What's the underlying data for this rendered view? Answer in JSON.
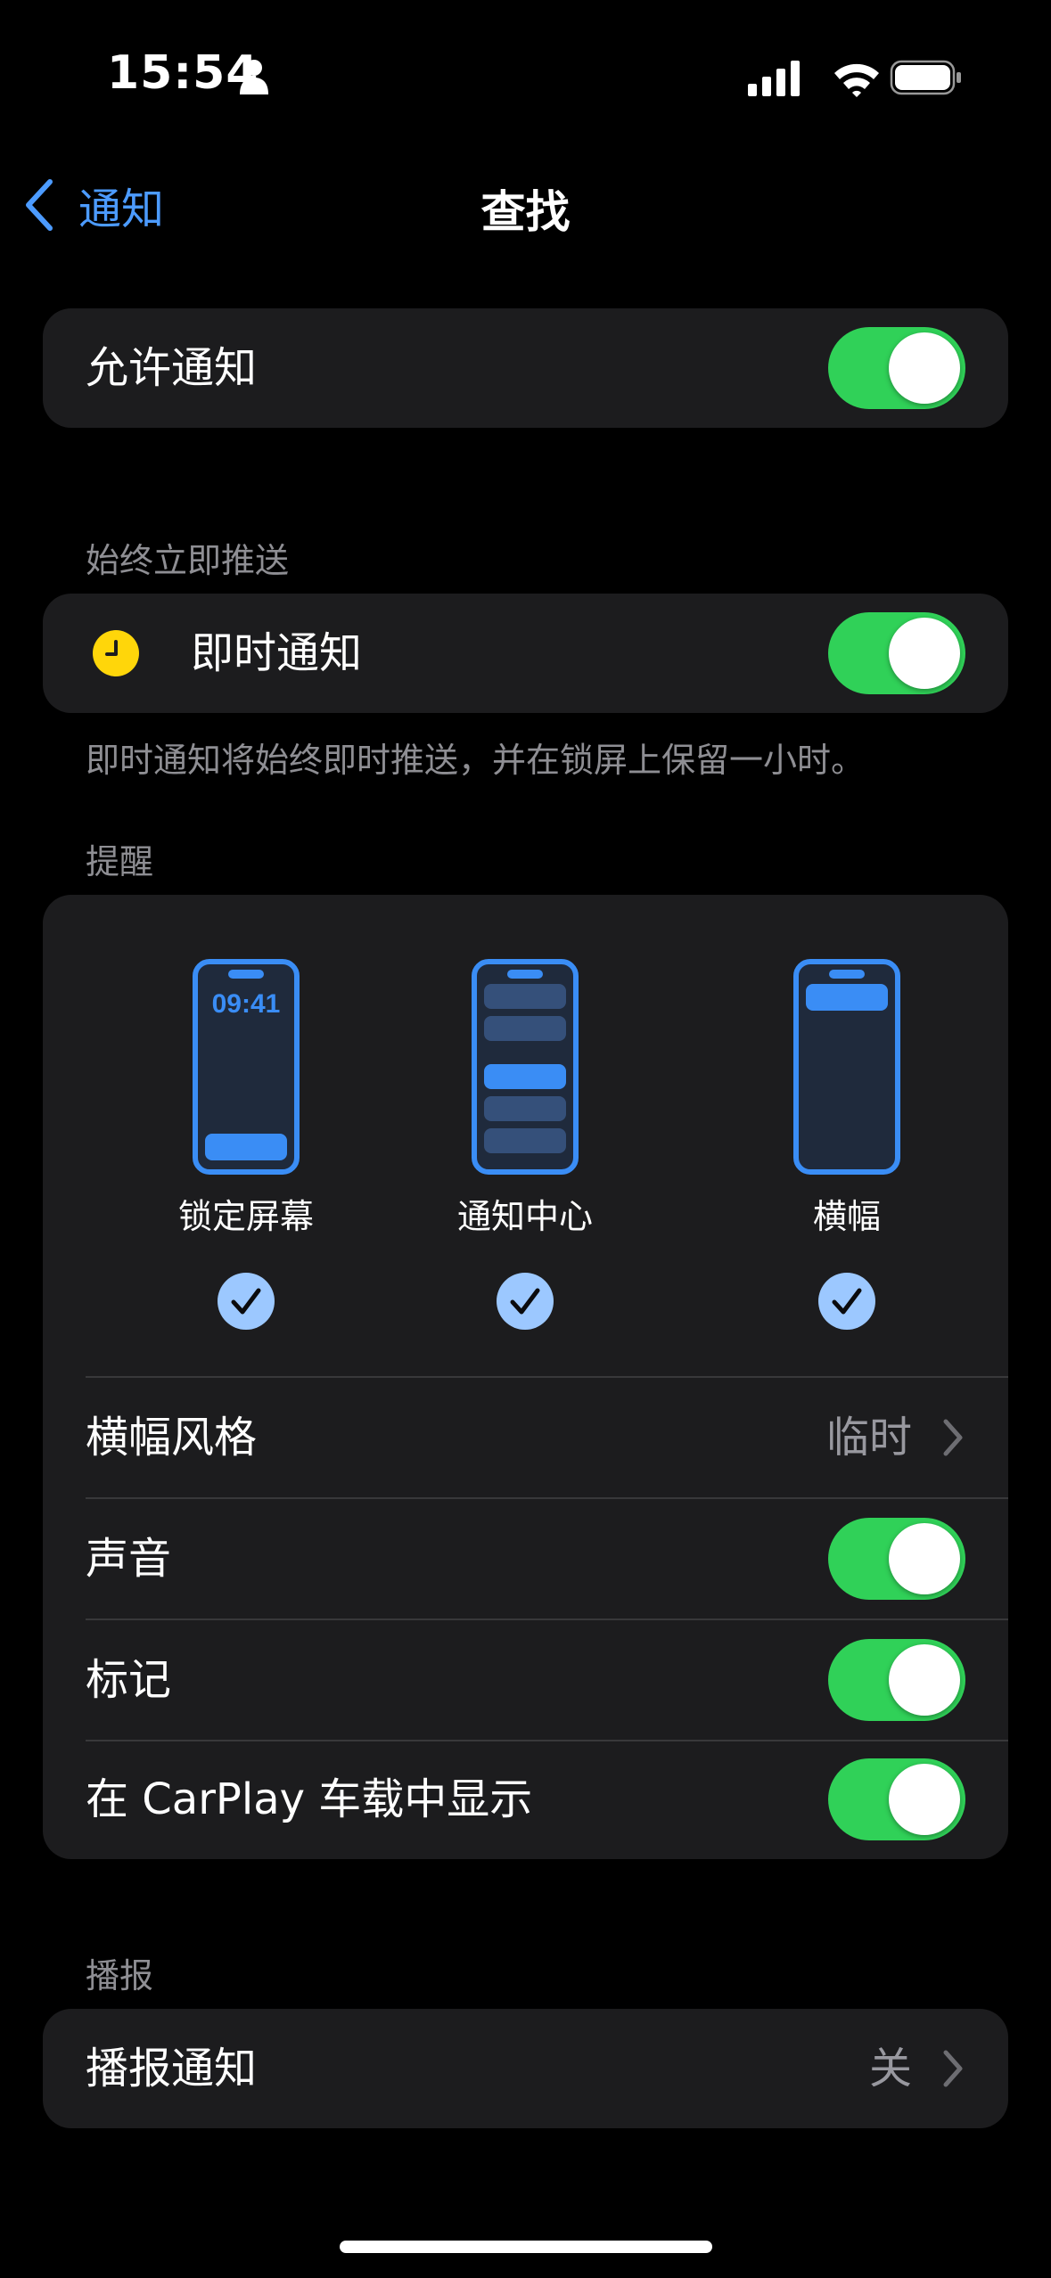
{
  "status_bar": {
    "time": "15:54",
    "icons": [
      "person-icon",
      "signal-icon",
      "wifi-icon",
      "battery-icon"
    ]
  },
  "nav": {
    "back_label": "通知",
    "title": "查找"
  },
  "allow_notifications": {
    "label": "允许通知",
    "on": true
  },
  "always_deliver": {
    "header": "始终立即推送",
    "time_sensitive_label": "即时通知",
    "time_sensitive_on": true,
    "footer": "即时通知将始终即时推送，并在锁屏上保留一小时。"
  },
  "alerts": {
    "header": "提醒",
    "options": [
      {
        "label": "锁定屏幕",
        "checked": true,
        "preview_time": "09:41"
      },
      {
        "label": "通知中心",
        "checked": true
      },
      {
        "label": "横幅",
        "checked": true
      }
    ],
    "banner_style_label": "横幅风格",
    "banner_style_value": "临时",
    "sounds_label": "声音",
    "sounds_on": true,
    "badges_label": "标记",
    "badges_on": true,
    "carplay_label": "在 CarPlay 车载中显示",
    "carplay_on": true
  },
  "announce": {
    "header": "播报",
    "label": "播报通知",
    "value": "关"
  },
  "colors": {
    "accent": "#4c9bff",
    "toggle_on": "#30d158",
    "group_bg": "#1c1c1e",
    "secondary_text": "#8e8e93",
    "clock_yellow": "#ffd60a"
  }
}
